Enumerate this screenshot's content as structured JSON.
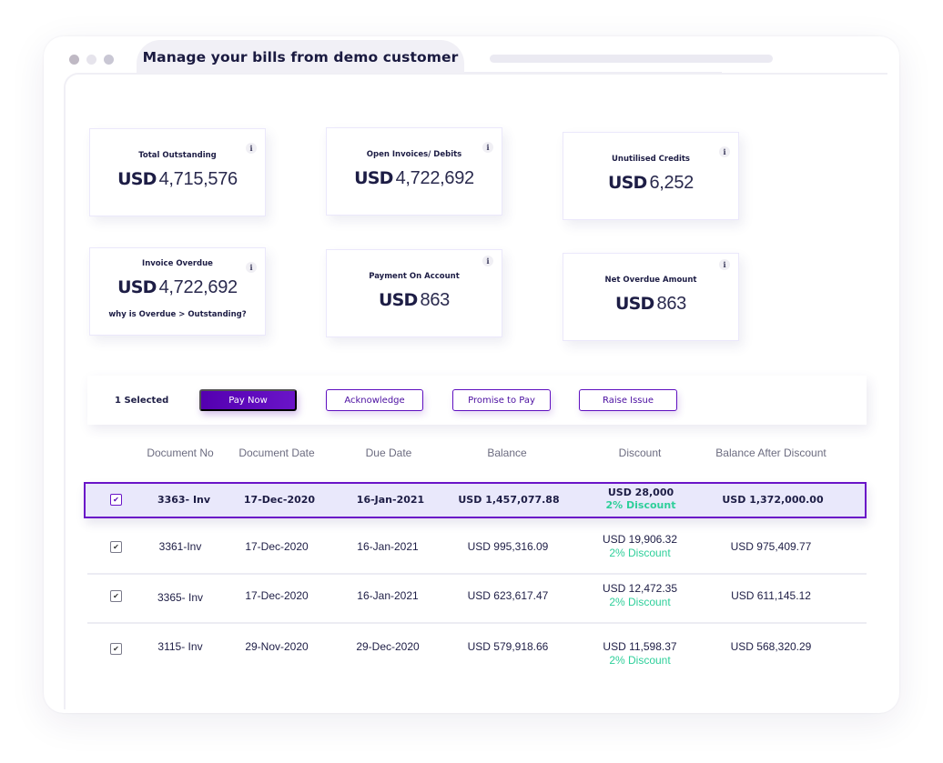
{
  "window": {
    "tab_title": "Manage your bills from demo customer"
  },
  "summary_cards": [
    {
      "title": "Total Outstanding",
      "currency": "USD",
      "amount": "4,715,576",
      "note": null,
      "info_icon": "i"
    },
    {
      "title": "Open Invoices/ Debits",
      "currency": "USD",
      "amount": "4,722,692",
      "note": null,
      "info_icon": "i"
    },
    {
      "title": "Unutilised Credits",
      "currency": "USD",
      "amount": "6,252",
      "note": null,
      "info_icon": "i"
    },
    {
      "title": "Invoice Overdue",
      "currency": "USD",
      "amount": "4,722,692",
      "note": "why is Overdue > Outstanding?",
      "info_icon": "i"
    },
    {
      "title": "Payment On Account",
      "currency": "USD",
      "amount": "863",
      "note": null,
      "info_icon": "i"
    },
    {
      "title": "Net Overdue Amount",
      "currency": "USD",
      "amount": "863",
      "note": null,
      "info_icon": "i"
    }
  ],
  "action_bar": {
    "selected_label": "1 Selected",
    "buttons": {
      "pay_now": "Pay Now",
      "acknowledge": "Acknowledge",
      "promise_to_pay": "Promise to Pay",
      "raise_issue": "Raise Issue"
    }
  },
  "table": {
    "columns": [
      "Document No",
      "Document Date",
      "Due Date",
      "Balance",
      "Discount",
      "Balance After Discount"
    ],
    "rows": [
      {
        "checked": true,
        "selected": true,
        "doc_no": "3363- Inv",
        "doc_date": "17-Dec-2020",
        "due_date": "16-Jan-2021",
        "balance": "USD 1,457,077.88",
        "discount": "USD 28,000",
        "discount_pct": "2% Discount",
        "balance_after": "USD 1,372,000.00"
      },
      {
        "checked": true,
        "selected": false,
        "doc_no": "3361-Inv",
        "doc_date": "17-Dec-2020",
        "due_date": "16-Jan-2021",
        "balance": "USD 995,316.09",
        "discount": "USD 19,906.32",
        "discount_pct": "2% Discount",
        "balance_after": "USD 975,409.77"
      },
      {
        "checked": true,
        "selected": false,
        "doc_no": "3365- Inv",
        "doc_date": "17-Dec-2020",
        "due_date": "16-Jan-2021",
        "balance": "USD 623,617.47",
        "discount": "USD 12,472.35",
        "discount_pct": "2% Discount",
        "balance_after": "USD 611,145.12"
      },
      {
        "checked": true,
        "selected": false,
        "doc_no": "3115- Inv",
        "doc_date": "29-Nov-2020",
        "due_date": "29-Dec-2020",
        "balance": "USD 579,918.66",
        "discount": "USD 11,598.37",
        "discount_pct": "2% Discount",
        "balance_after": "USD 568,320.29"
      }
    ],
    "checkbox_glyph": "✔"
  },
  "colors": {
    "primary": "#5400B0",
    "discount_green": "#2ECF9A",
    "selected_row_bg": "#E9E8FB",
    "text_dark": "#1D1D45"
  }
}
